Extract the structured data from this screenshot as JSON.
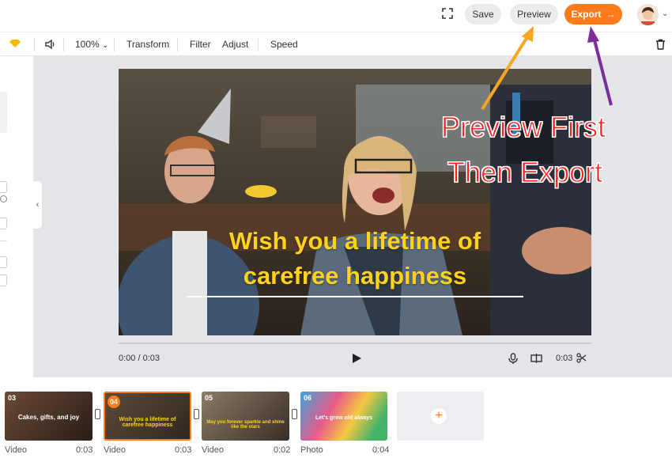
{
  "topbar": {
    "save_label": "Save",
    "preview_label": "Preview",
    "export_label": "Export"
  },
  "toolbar": {
    "zoom": "100%",
    "transform": "Transform",
    "filter": "Filter",
    "adjust": "Adjust",
    "speed": "Speed"
  },
  "player": {
    "caption_line1": "Wish you a lifetime of",
    "caption_line2": "carefree happiness",
    "current_time": "0:00 / 0:03",
    "duration": "0:03"
  },
  "annotation": {
    "line1": "Preview First",
    "line2": "Then Export"
  },
  "timeline": {
    "clips": [
      {
        "num": "03",
        "text": "Cakes, gifts, and joy",
        "type": "Video",
        "duration": "0:03"
      },
      {
        "num": "04",
        "text": "Wish you a lifetime of carefree happiness",
        "type": "Video",
        "duration": "0:03"
      },
      {
        "num": "05",
        "text": "May you forever sparkle and shine like the stars",
        "type": "Video",
        "duration": "0:02"
      },
      {
        "num": "06",
        "text": "Let's grow old always",
        "type": "Photo",
        "duration": "0:04"
      }
    ]
  },
  "colors": {
    "accent": "#ff7a1a",
    "caption": "#ffd21c",
    "annotation": "#ff2020",
    "arrow_orange": "#f5a623",
    "arrow_purple": "#7b2d9c"
  }
}
